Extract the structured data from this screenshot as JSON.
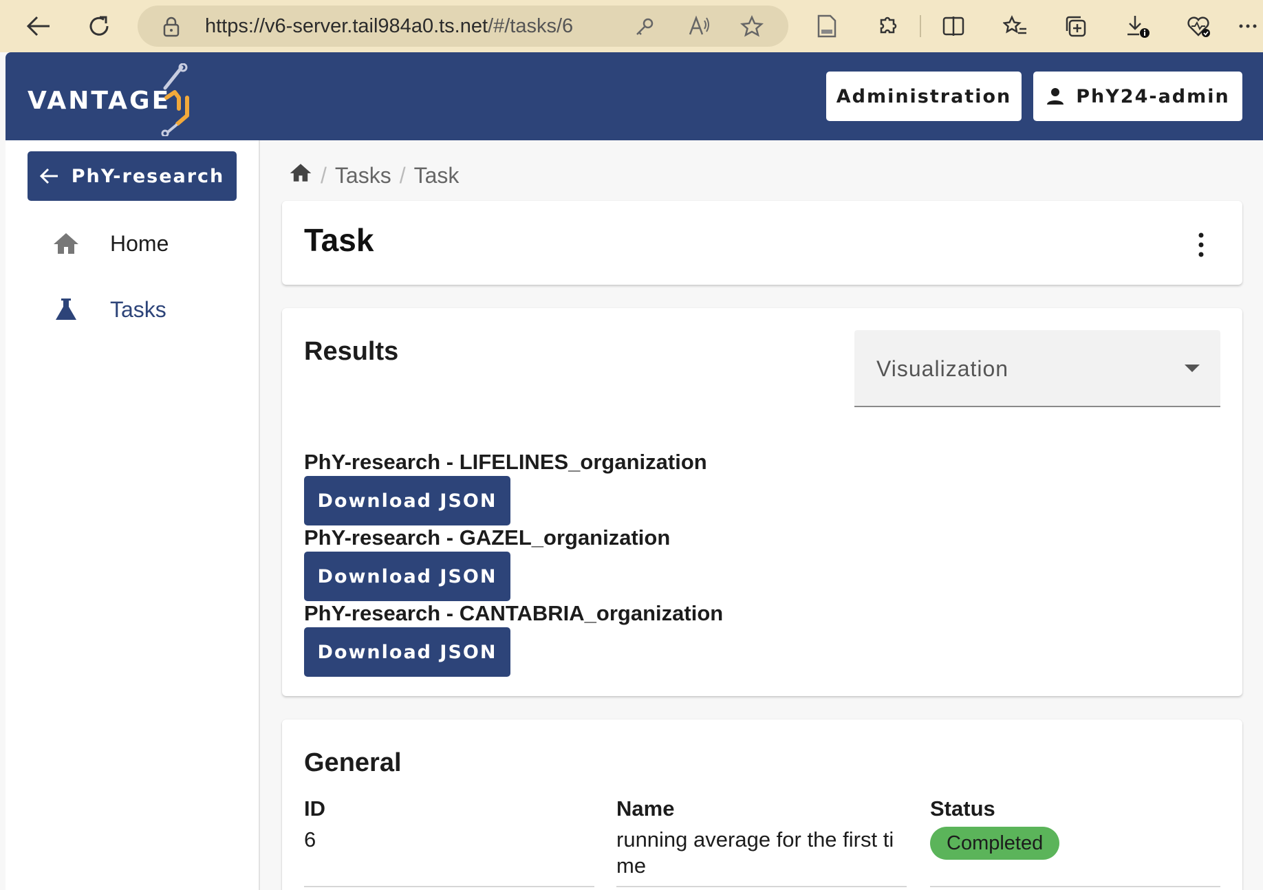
{
  "browser": {
    "url_host": "https://v6-server.tail984a0.ts.net",
    "url_path": "/#/tasks/6"
  },
  "header": {
    "logo": "VANTAGE",
    "admin_label": "Administration",
    "user_label": "PhY24-admin"
  },
  "sidebar": {
    "back_label": "PhY-research",
    "items": [
      {
        "label": "Home",
        "icon": "home-icon"
      },
      {
        "label": "Tasks",
        "icon": "flask-icon"
      }
    ]
  },
  "breadcrumb": {
    "items": [
      "Tasks",
      "Task"
    ]
  },
  "task_card": {
    "title": "Task"
  },
  "results": {
    "title": "Results",
    "select_label": "Visualization",
    "orgs": [
      {
        "label": "PhY-research - LIFELINES_organization",
        "button": "Download JSON"
      },
      {
        "label": "PhY-research - GAZEL_organization",
        "button": "Download JSON"
      },
      {
        "label": "PhY-research - CANTABRIA_organization",
        "button": "Download JSON"
      }
    ]
  },
  "general": {
    "title": "General",
    "id_label": "ID",
    "id_value": "6",
    "name_label": "Name",
    "name_value_line1": "running average for the first ti",
    "name_value_line2": "me",
    "status_label": "Status",
    "status_value": "Completed",
    "status_color": "#5bb45a"
  },
  "colors": {
    "primary": "#2d4479",
    "chrome": "#f3e7c6",
    "logo_accent": "#f2a93b"
  }
}
